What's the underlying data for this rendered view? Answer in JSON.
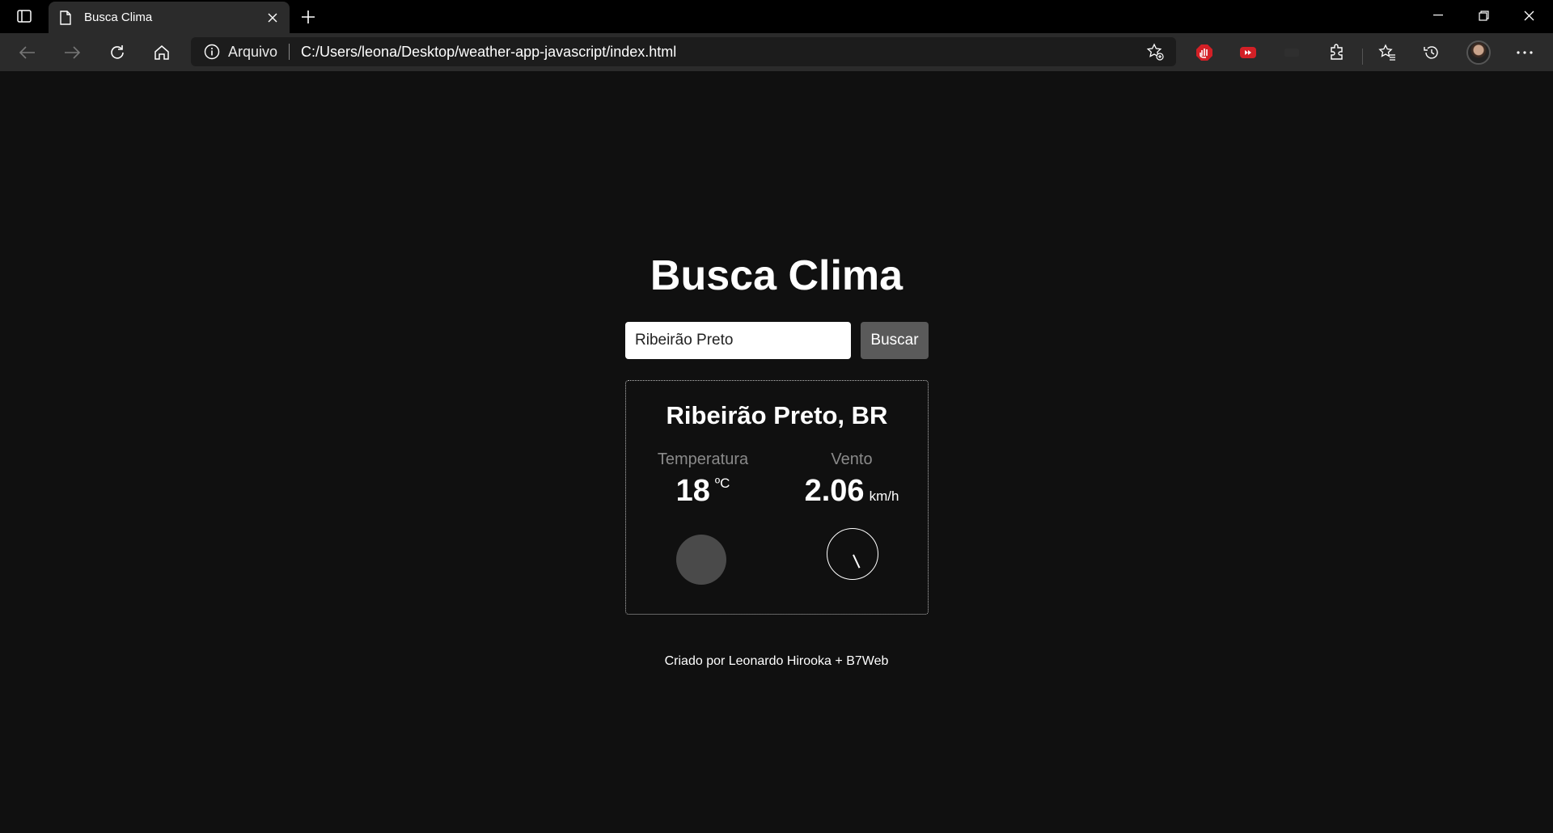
{
  "browser": {
    "tab_title": "Busca Clima",
    "address_scheme": "Arquivo",
    "address_url": "C:/Users/leona/Desktop/weather-app-javascript/index.html"
  },
  "app": {
    "title": "Busca Clima",
    "search": {
      "value": "Ribeirão Preto",
      "button_label": "Buscar"
    },
    "result": {
      "city": "Ribeirão Preto, BR",
      "temperature": {
        "label": "Temperatura",
        "value": "18",
        "unit": "ºC"
      },
      "wind": {
        "label": "Vento",
        "value": "2.06",
        "unit": "km/h",
        "direction_deg": 155
      }
    },
    "credit": "Criado por Leonardo Hirooka + B7Web"
  },
  "colors": {
    "page_background": "#101010",
    "temperature_indicator": "#4a4a4a",
    "button_background": "#5a5a5a"
  }
}
